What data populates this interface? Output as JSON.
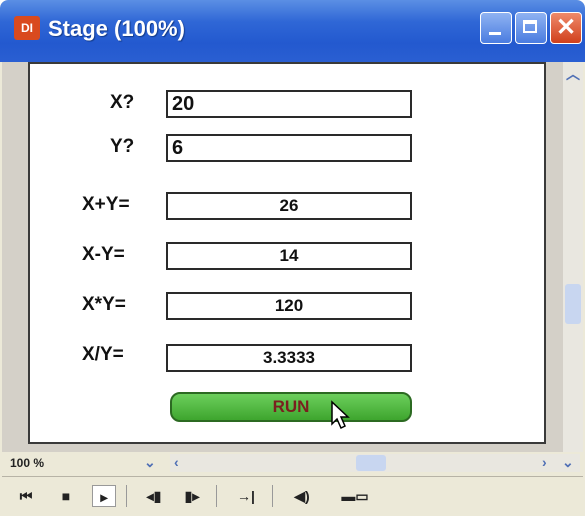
{
  "window": {
    "title": "Stage (100%)",
    "app_icon_text": "DI",
    "controls": [
      "minimize",
      "maximize",
      "close"
    ]
  },
  "form": {
    "x_label": "X?",
    "x_value": "20",
    "y_label": "Y?",
    "y_value": "6",
    "results": [
      {
        "label": "X+Y=",
        "value": "26"
      },
      {
        "label": "X-Y=",
        "value": "14"
      },
      {
        "label": "X*Y=",
        "value": "120"
      },
      {
        "label": "X/Y=",
        "value": "3.3333"
      }
    ],
    "run_label": "RUN"
  },
  "status": {
    "zoom": "100 %"
  },
  "transport": {
    "icons": [
      "rewind-to-start",
      "stop",
      "play",
      "step-back",
      "step-forward",
      "jump",
      "volume",
      "keyboard"
    ]
  },
  "colors": {
    "title_bar": "#2f67d6",
    "run_button": "#4fb53f",
    "run_text": "#7a1f1f",
    "close_button": "#d0401c"
  }
}
